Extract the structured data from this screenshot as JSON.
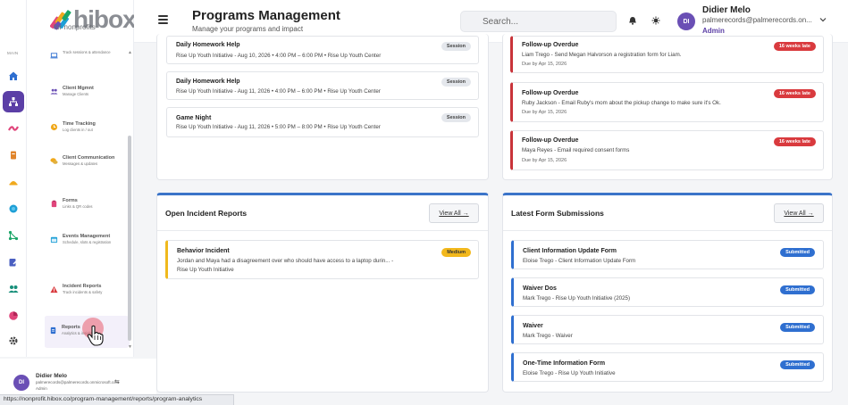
{
  "brand": {
    "logo_text": "hibox",
    "logo_sub": "for nonprofits"
  },
  "rail": {
    "label": "MAIN",
    "icons": [
      "home-icon",
      "sitemap-icon",
      "wave-icon",
      "document-icon",
      "clock-icon",
      "circle-icon",
      "network-icon",
      "edit-icon",
      "users-icon",
      "chart-pie-icon",
      "gear-icon"
    ]
  },
  "sidebar": {
    "items": [
      {
        "title": "",
        "desc": "Track sessions & attendance"
      },
      {
        "title": "Client Mgmnt",
        "desc": "Manage Clients"
      },
      {
        "title": "Time Tracking",
        "desc": "Log clients in / out"
      },
      {
        "title": "Client Communication",
        "desc": "Messages & updates"
      },
      {
        "title": "Forms",
        "desc": "Links & QR codes"
      },
      {
        "title": "Events Management",
        "desc": "Schedule, slots & registration"
      },
      {
        "title": "Incident Reports",
        "desc": "Track incidents & safety"
      },
      {
        "title": "Reports",
        "desc": "Analytics & insights"
      }
    ],
    "user": {
      "initials": "DI",
      "name": "Didier Melo",
      "email": "palmerecords@palmerecords.onmicrosoft.com",
      "role": "Admin"
    }
  },
  "header": {
    "title": "Programs Management",
    "subtitle": "Manage your programs and impact",
    "search_placeholder": "Search...",
    "user": {
      "initials": "DI",
      "name": "Didier Melo",
      "email": "palmerecords@palmerecords.on...",
      "role": "Admin"
    }
  },
  "sessions": [
    {
      "title": "Daily Homework Help",
      "details": "Rise Up Youth Initiative - Aug 10, 2026 • 4:00 PM – 6:00 PM • Rise Up Youth Center",
      "tag": "Session"
    },
    {
      "title": "Daily Homework Help",
      "details": "Rise Up Youth Initiative - Aug 11, 2026 • 4:00 PM – 6:00 PM • Rise Up Youth Center",
      "tag": "Session"
    },
    {
      "title": "Game Night",
      "details": "Rise Up Youth Initiative - Aug 11, 2026 • 5:00 PM – 8:00 PM • Rise Up Youth Center",
      "tag": "Session"
    }
  ],
  "followups": [
    {
      "title": "Follow-up Overdue",
      "details": "Liam Trego - Send Megan Halvorson a registration form for Liam.",
      "due": "Due by Apr 15, 2026",
      "tag": "16 weeks late"
    },
    {
      "title": "Follow-up Overdue",
      "details": "Ruby Jackson - Email Ruby's mom about the pickup change to make sure it's Ok.",
      "due": "Due by Apr 15, 2026",
      "tag": "16 weeks late"
    },
    {
      "title": "Follow-up Overdue",
      "details": "Maya Reyes - Email required consent forms",
      "due": "Due by Apr 15, 2026",
      "tag": "16 weeks late"
    }
  ],
  "incidents": {
    "title": "Open Incident Reports",
    "view_all": "View All →",
    "items": [
      {
        "title": "Behavior Incident",
        "line1": "Jordan and Maya had a disagreement over who should have access to a laptop durin... -",
        "line2": "Rise Up Youth Initiative",
        "tag": "Medium"
      }
    ]
  },
  "forms": {
    "title": "Latest Form Submissions",
    "view_all": "View All →",
    "items": [
      {
        "title": "Client Information Update Form",
        "details": "Eloise Trego - Client Information Update Form",
        "tag": "Submitted"
      },
      {
        "title": "Waiver Dos",
        "details": "Mark Trego - Rise Up Youth Initiative (2025)",
        "tag": "Submitted"
      },
      {
        "title": "Waiver",
        "details": "Mark Trego - Waiver",
        "tag": "Submitted"
      },
      {
        "title": "One-Time Information Form",
        "details": "Eloise Trego - Rise Up Youth Initiative",
        "tag": "Submitted"
      }
    ]
  },
  "status_url": "https://nonprofit.hibox.co/program-management/reports/program-analytics",
  "colors": {
    "accent": "#5b3fa6",
    "late": "#d93a3e",
    "submitted": "#2f6fd0",
    "medium": "#f2b81c"
  }
}
